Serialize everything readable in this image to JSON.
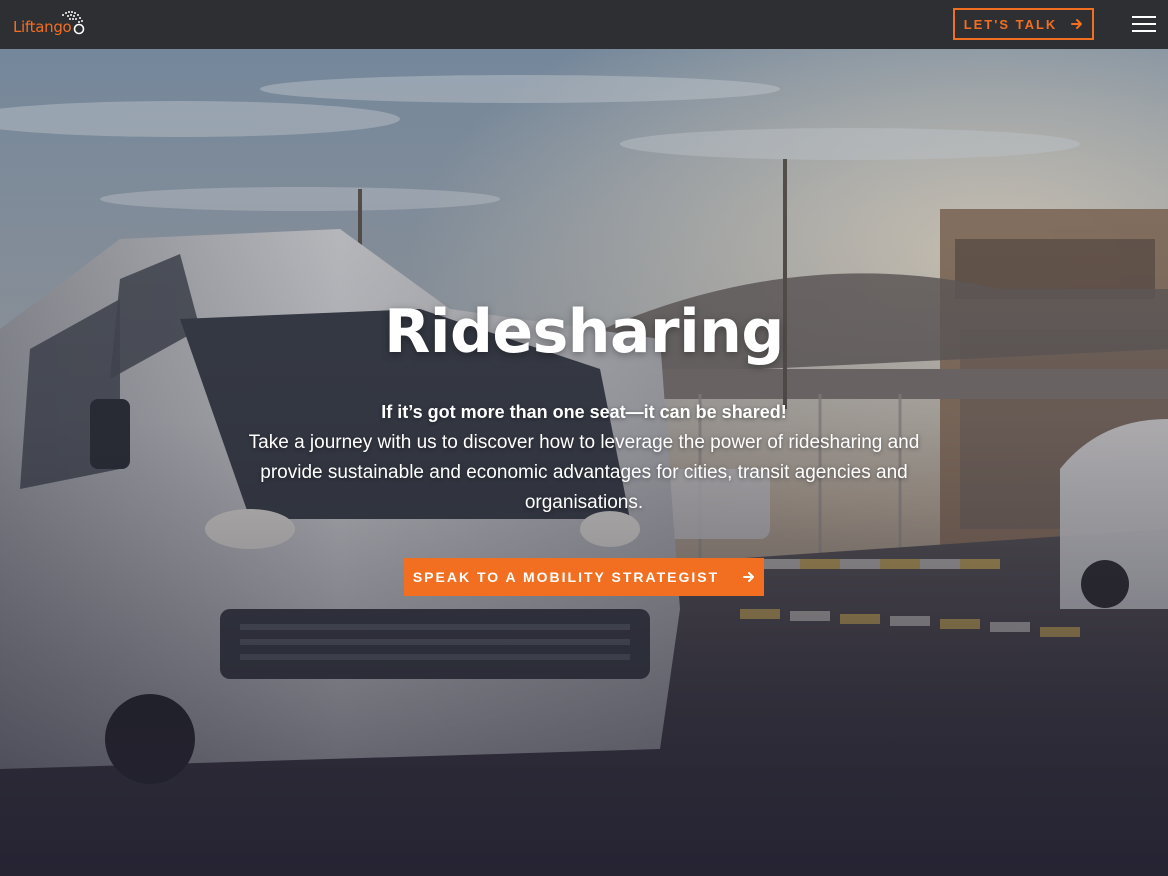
{
  "brand": {
    "logo_text": "Liftango",
    "accent_color": "#f26f21"
  },
  "nav": {
    "cta_label": "LET'S TALK",
    "cta_icon": "arrow-right-icon",
    "menu_icon": "hamburger-menu-icon"
  },
  "hero": {
    "title": "Ridesharing",
    "tagline": "If it’s got more than one seat—it can be shared!",
    "body": "Take a journey with us to discover how to leverage the power of ridesharing and provide sustainable and economic advantages for cities, transit agencies and organisations.",
    "cta_label": "SPEAK TO A MOBILITY STRATEGIST",
    "cta_icon": "arrow-right-icon"
  }
}
